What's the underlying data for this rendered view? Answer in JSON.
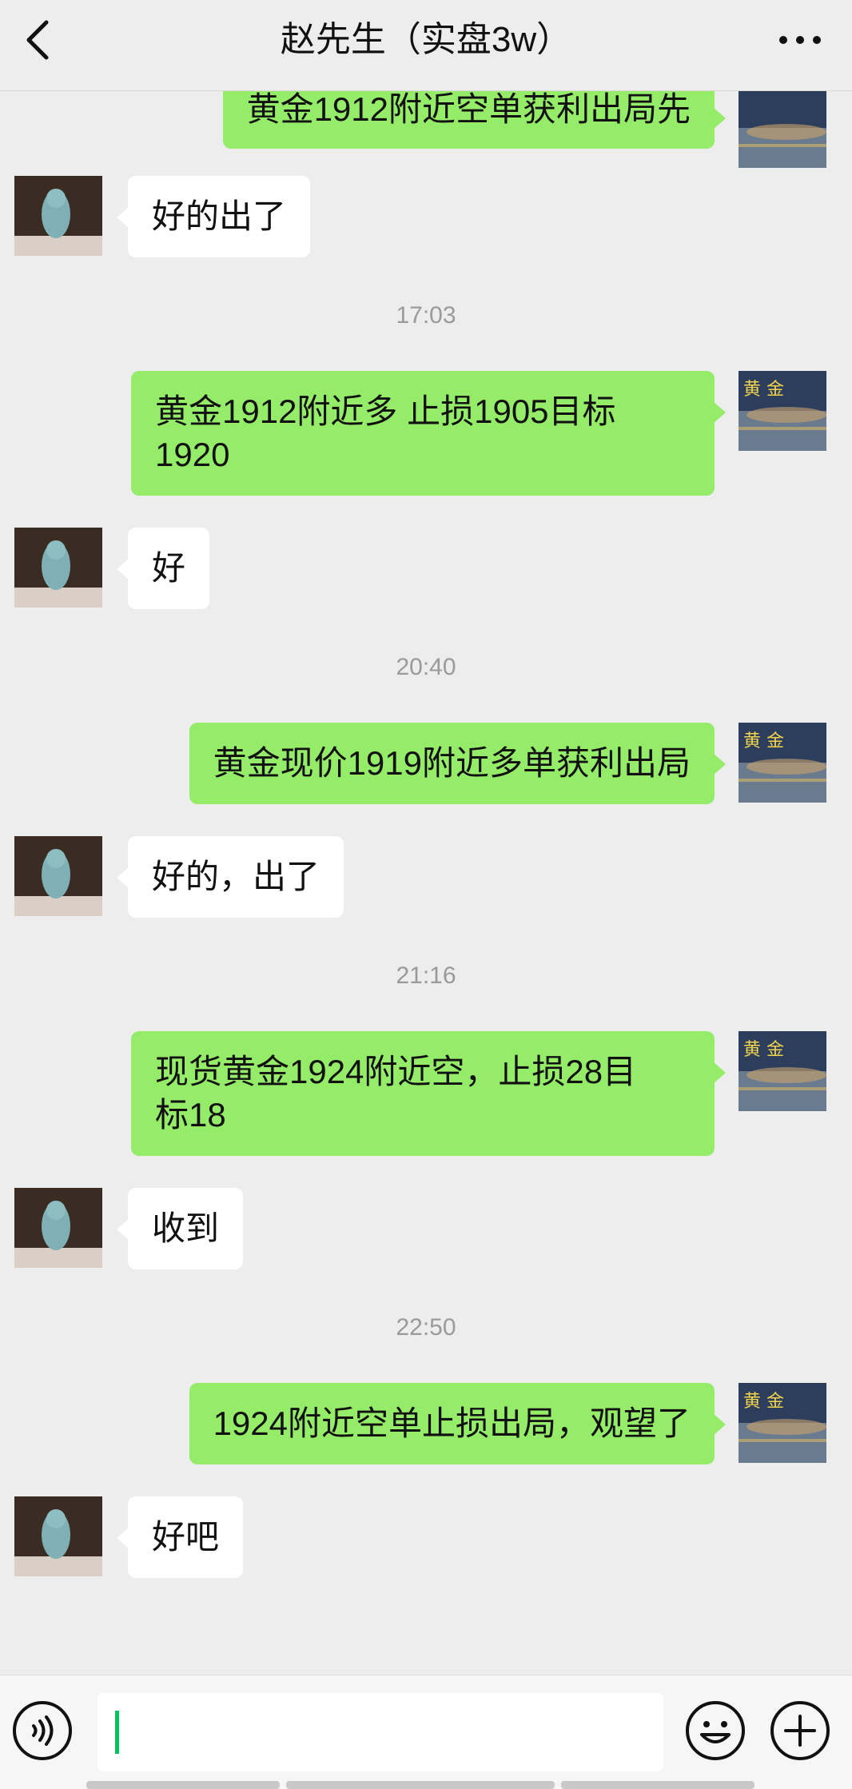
{
  "header": {
    "title": "赵先生（实盘3w）"
  },
  "messages": [
    {
      "text": "黄金1912附近空单获利出局先"
    },
    {
      "text": "好的出了"
    },
    {
      "time": "17:03"
    },
    {
      "text": "黄金1912附近多 止损1905目标\n1920"
    },
    {
      "text": "好"
    },
    {
      "time": "20:40"
    },
    {
      "text": "黄金现价1919附近多单获利出局"
    },
    {
      "text": "好的，出了"
    },
    {
      "time": "21:16"
    },
    {
      "text": "现货黄金1924附近空，止损28目\n标18"
    },
    {
      "text": "收到"
    },
    {
      "time": "22:50"
    },
    {
      "text": "1924附近空单止损出局，观望了"
    },
    {
      "text": "好吧"
    }
  ],
  "avatar_label": "黄 金",
  "colors": {
    "outgoing_bubble": "#95ec69",
    "incoming_bubble": "#ffffff",
    "background": "#ededed",
    "caret": "#07c160"
  },
  "icons": {
    "back": "chevron-left-icon",
    "more": "more-dots-icon",
    "voice": "voice-icon",
    "emoji": "emoji-icon",
    "plus": "plus-icon"
  }
}
